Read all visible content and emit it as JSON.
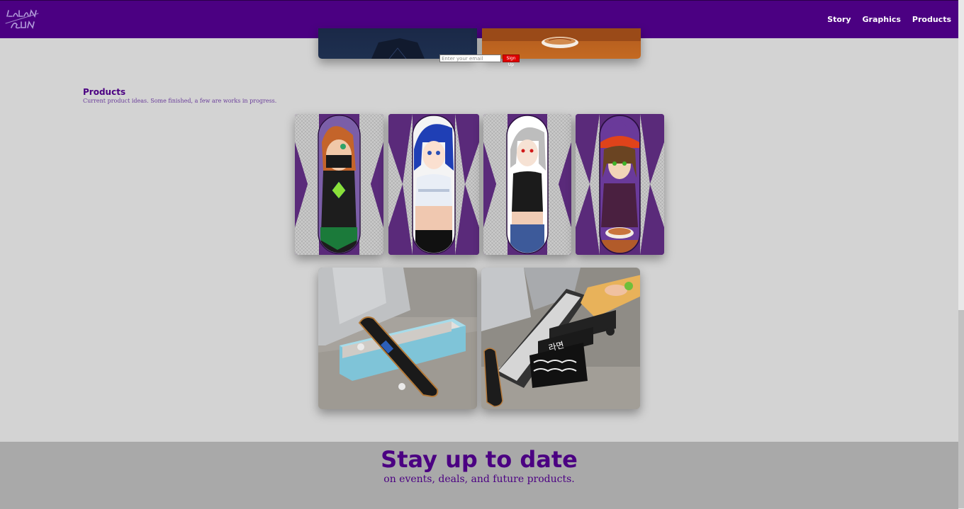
{
  "nav": {
    "logo_text": "Salona Sun",
    "links": [
      {
        "label": "Story"
      },
      {
        "label": "Graphics"
      },
      {
        "label": "Products"
      }
    ]
  },
  "products": {
    "title": "Products",
    "description": "Current product ideas. Some finished, a few are works in progress."
  },
  "footer": {
    "title": "Stay up to date",
    "subtitle": "on events, deals, and future products.",
    "email_placeholder": "Enter your email",
    "submit_label": "Sign Up"
  },
  "colors": {
    "navbar": "#4b0082",
    "page_bg": "#d3d3d3",
    "footer_bg": "#a9a9a9",
    "accent": "#4b0082",
    "deck_bg": "#5a2a7a",
    "submit": "#e00000"
  }
}
